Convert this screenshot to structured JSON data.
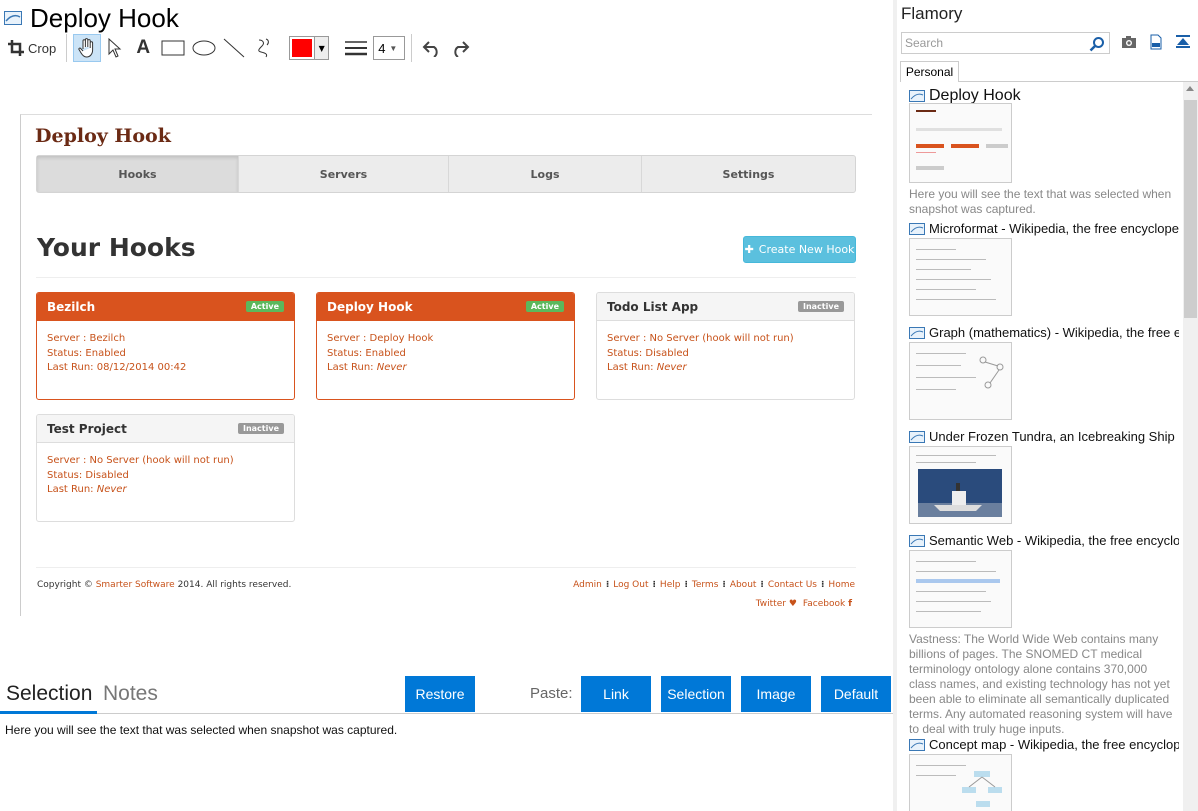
{
  "window": {
    "title": "Deploy Hook"
  },
  "toolbar": {
    "crop_label": "Crop",
    "line_width": "4"
  },
  "colors": {
    "accent": "#0078d7",
    "pen_color": "#ff0000",
    "brand": "#d9531e",
    "link": "#c7521a"
  },
  "snapshot": {
    "brand": "Deploy Hook",
    "nav": [
      {
        "label": "Hooks"
      },
      {
        "label": "Servers"
      },
      {
        "label": "Logs"
      },
      {
        "label": "Settings"
      }
    ],
    "heading": "Your Hooks",
    "create_button": "Create New Hook",
    "cards": [
      {
        "title": "Bezilch",
        "badge": "Active",
        "server": "Server : Bezilch",
        "status": "Status: Enabled",
        "last_run_label": "Last Run: ",
        "last_run": "08/12/2014 00:42"
      },
      {
        "title": "Deploy Hook",
        "badge": "Active",
        "server": "Server : Deploy Hook",
        "status": "Status: Enabled",
        "last_run_label": "Last Run: ",
        "last_run": "Never"
      },
      {
        "title": "Todo List App",
        "badge": "Inactive",
        "server": "Server : No Server (hook will not run)",
        "status": "Status: Disabled",
        "last_run_label": "Last Run: ",
        "last_run": "Never"
      },
      {
        "title": "Test Project",
        "badge": "Inactive",
        "server": "Server : No Server (hook will not run)",
        "status": "Status: Disabled",
        "last_run_label": "Last Run: ",
        "last_run": "Never"
      }
    ],
    "footer": {
      "copyright_prefix": "Copyright © ",
      "copyright_link": "Smarter Software",
      "copyright_suffix": " 2014. All rights reserved.",
      "links": [
        "Admin",
        "Log Out",
        "Help",
        "Terms",
        "About",
        "Contact Us",
        "Home"
      ],
      "twitter": "Twitter",
      "facebook": "Facebook"
    }
  },
  "bottom": {
    "tab_selection": "Selection",
    "tab_notes": "Notes",
    "restore": "Restore",
    "paste_label": "Paste:",
    "paste_link": "Link",
    "paste_selection": "Selection",
    "paste_image": "Image",
    "paste_default": "Default",
    "selected_text": "Here you will see the text that was selected when snapshot was captured."
  },
  "sidebar": {
    "title": "Flamory",
    "search_placeholder": "Search",
    "tab": "Personal",
    "entries": [
      {
        "title": "Deploy Hook",
        "desc": "Here you will see the text that was selected when snapshot was captured."
      },
      {
        "title": "Microformat - Wikipedia, the free encyclopedia",
        "desc": ""
      },
      {
        "title": "Graph (mathematics) - Wikipedia, the free ency",
        "desc": ""
      },
      {
        "title": "Under Frozen Tundra, an Icebreaking Ship Unco",
        "desc": ""
      },
      {
        "title": "Semantic Web - Wikipedia, the free encycloped",
        "desc": "Vastness: The World Wide Web contains many billions of pages. The SNOMED CT medical terminology ontology alone contains 370,000 class names, and existing technology has not yet been able to eliminate all semantically duplicated terms. Any automated reasoning system will have to deal with truly huge inputs."
      },
      {
        "title": "Concept map - Wikipedia, the free encyclopedia",
        "desc": ""
      }
    ]
  }
}
